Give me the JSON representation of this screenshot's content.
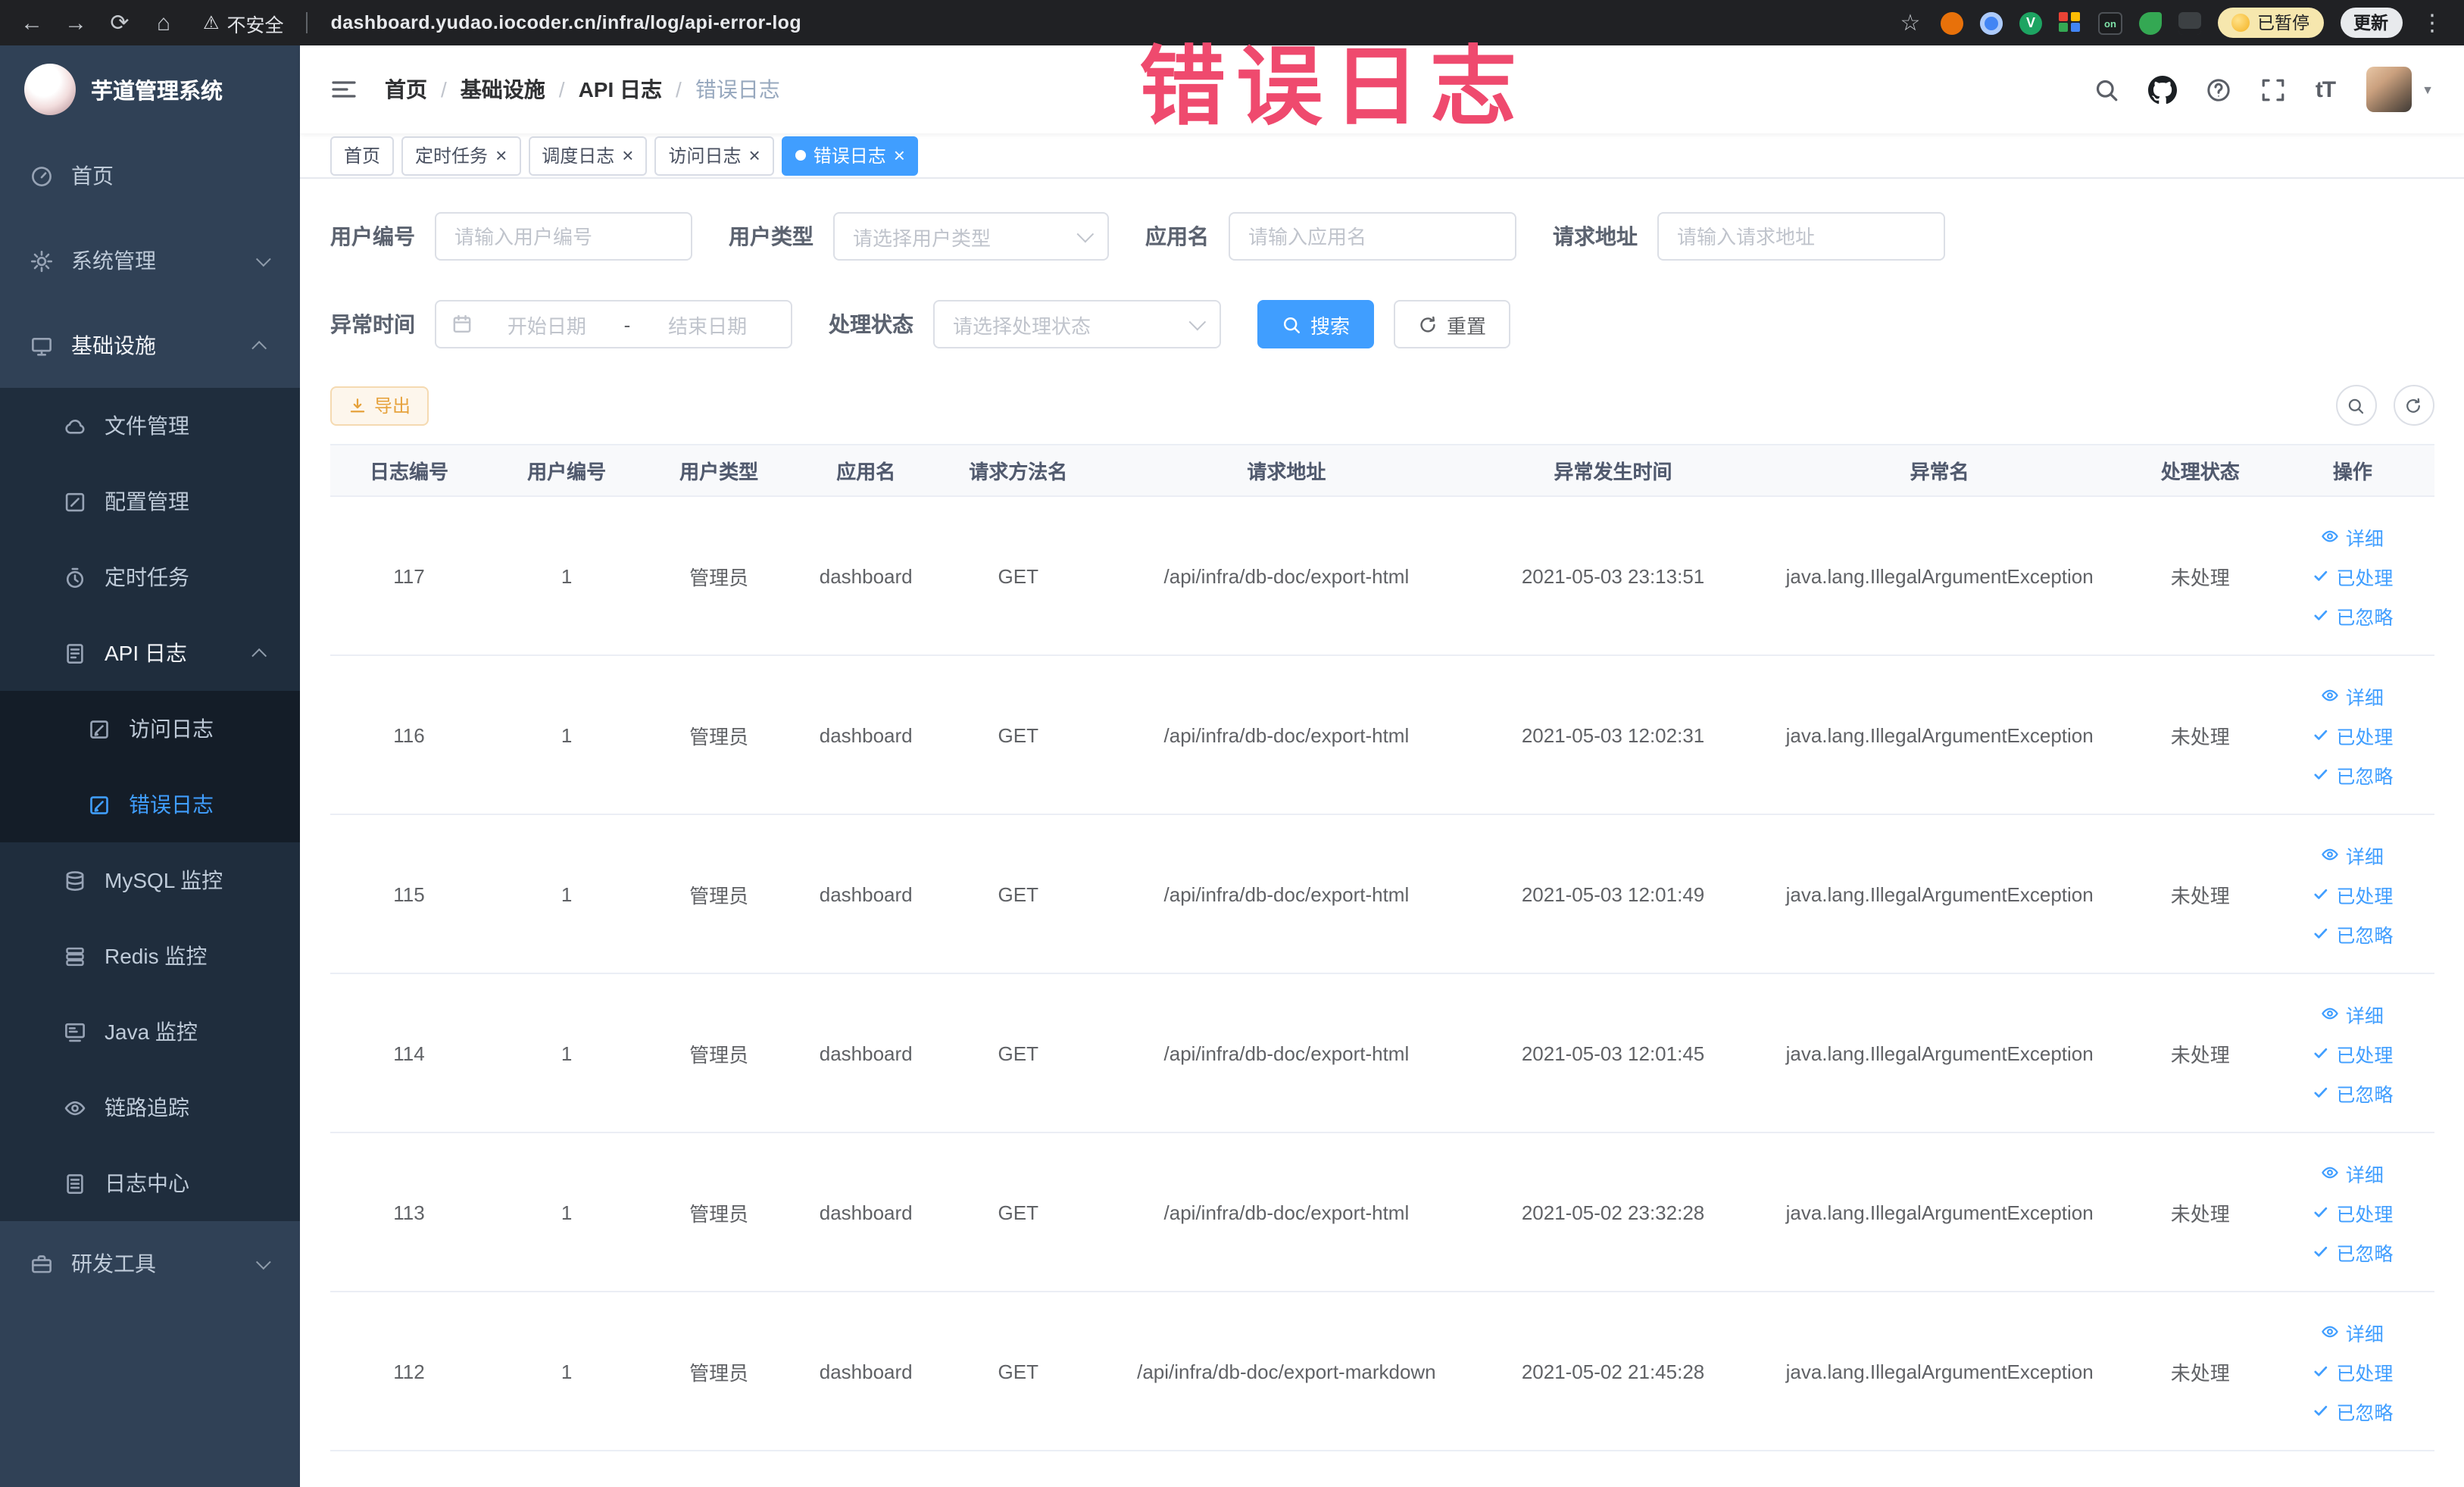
{
  "watermark": "错误日志",
  "browser": {
    "security_label": "不安全",
    "url": "dashboard.yudao.iocoder.cn/infra/log/api-error-log",
    "paused_badge": "已暂停",
    "update_button": "更新"
  },
  "sidebar": {
    "logo_title": "芋道管理系统",
    "items": [
      {
        "label": "首页",
        "level": 1,
        "icon": "home-icon"
      },
      {
        "label": "系统管理",
        "level": 1,
        "icon": "gear-icon",
        "chevron": "down"
      },
      {
        "label": "基础设施",
        "level": 1,
        "icon": "monitor-icon",
        "chevron": "up",
        "open": true
      },
      {
        "label": "文件管理",
        "level": 2,
        "icon": "cloud-icon"
      },
      {
        "label": "配置管理",
        "level": 2,
        "icon": "edit-icon"
      },
      {
        "label": "定时任务",
        "level": 2,
        "icon": "timer-icon"
      },
      {
        "label": "API 日志",
        "level": 2,
        "icon": "log-icon",
        "chevron": "up",
        "open": true
      },
      {
        "label": "访问日志",
        "level": 3,
        "icon": "doc-icon"
      },
      {
        "label": "错误日志",
        "level": 3,
        "icon": "doc-icon",
        "active": true
      },
      {
        "label": "MySQL 监控",
        "level": 2,
        "icon": "database-icon"
      },
      {
        "label": "Redis 监控",
        "level": 2,
        "icon": "stack-icon"
      },
      {
        "label": "Java 监控",
        "level": 2,
        "icon": "java-icon"
      },
      {
        "label": "链路追踪",
        "level": 2,
        "icon": "trace-icon"
      },
      {
        "label": "日志中心",
        "level": 2,
        "icon": "doc-center-icon"
      },
      {
        "label": "研发工具",
        "level": 1,
        "icon": "tools-icon",
        "chevron": "down"
      }
    ]
  },
  "header": {
    "breadcrumb": [
      "首页",
      "基础设施",
      "API 日志",
      "错误日志"
    ]
  },
  "tabs": [
    {
      "label": "首页",
      "closable": false,
      "active": false
    },
    {
      "label": "定时任务",
      "closable": true,
      "active": false
    },
    {
      "label": "调度日志",
      "closable": true,
      "active": false
    },
    {
      "label": "访问日志",
      "closable": true,
      "active": false
    },
    {
      "label": "错误日志",
      "closable": true,
      "active": true
    }
  ],
  "filters": {
    "user_id_label": "用户编号",
    "user_id_placeholder": "请输入用户编号",
    "user_type_label": "用户类型",
    "user_type_placeholder": "请选择用户类型",
    "app_name_label": "应用名",
    "app_name_placeholder": "请输入应用名",
    "request_url_label": "请求地址",
    "request_url_placeholder": "请输入请求地址",
    "exception_time_label": "异常时间",
    "date_start_placeholder": "开始日期",
    "date_separator": "-",
    "date_end_placeholder": "结束日期",
    "process_status_label": "处理状态",
    "process_status_placeholder": "请选择处理状态",
    "search_button": "搜索",
    "reset_button": "重置"
  },
  "toolbar": {
    "export_button": "导出"
  },
  "table": {
    "columns": [
      "日志编号",
      "用户编号",
      "用户类型",
      "应用名",
      "请求方法名",
      "请求地址",
      "异常发生时间",
      "异常名",
      "处理状态",
      "操作"
    ],
    "action_labels": [
      "详细",
      "已处理",
      "已忽略"
    ],
    "rows": [
      {
        "log_id": "117",
        "user_id": "1",
        "user_type": "管理员",
        "app_name": "dashboard",
        "method": "GET",
        "request_url": "/api/infra/db-doc/export-html",
        "time": "2021-05-03 23:13:51",
        "exception": "java.lang.IllegalArgumentException",
        "status": "未处理"
      },
      {
        "log_id": "116",
        "user_id": "1",
        "user_type": "管理员",
        "app_name": "dashboard",
        "method": "GET",
        "request_url": "/api/infra/db-doc/export-html",
        "time": "2021-05-03 12:02:31",
        "exception": "java.lang.IllegalArgumentException",
        "status": "未处理"
      },
      {
        "log_id": "115",
        "user_id": "1",
        "user_type": "管理员",
        "app_name": "dashboard",
        "method": "GET",
        "request_url": "/api/infra/db-doc/export-html",
        "time": "2021-05-03 12:01:49",
        "exception": "java.lang.IllegalArgumentException",
        "status": "未处理"
      },
      {
        "log_id": "114",
        "user_id": "1",
        "user_type": "管理员",
        "app_name": "dashboard",
        "method": "GET",
        "request_url": "/api/infra/db-doc/export-html",
        "time": "2021-05-03 12:01:45",
        "exception": "java.lang.IllegalArgumentException",
        "status": "未处理"
      },
      {
        "log_id": "113",
        "user_id": "1",
        "user_type": "管理员",
        "app_name": "dashboard",
        "method": "GET",
        "request_url": "/api/infra/db-doc/export-html",
        "time": "2021-05-02 23:32:28",
        "exception": "java.lang.IllegalArgumentException",
        "status": "未处理"
      },
      {
        "log_id": "112",
        "user_id": "1",
        "user_type": "管理员",
        "app_name": "dashboard",
        "method": "GET",
        "request_url": "/api/infra/db-doc/export-markdown",
        "time": "2021-05-02 21:45:28",
        "exception": "java.lang.IllegalArgumentException",
        "status": "未处理"
      }
    ]
  },
  "colors": {
    "accent": "#409eff",
    "sidebar_bg": "#304156",
    "watermark": "#ef4a6e",
    "warning": "#e6a23c"
  }
}
